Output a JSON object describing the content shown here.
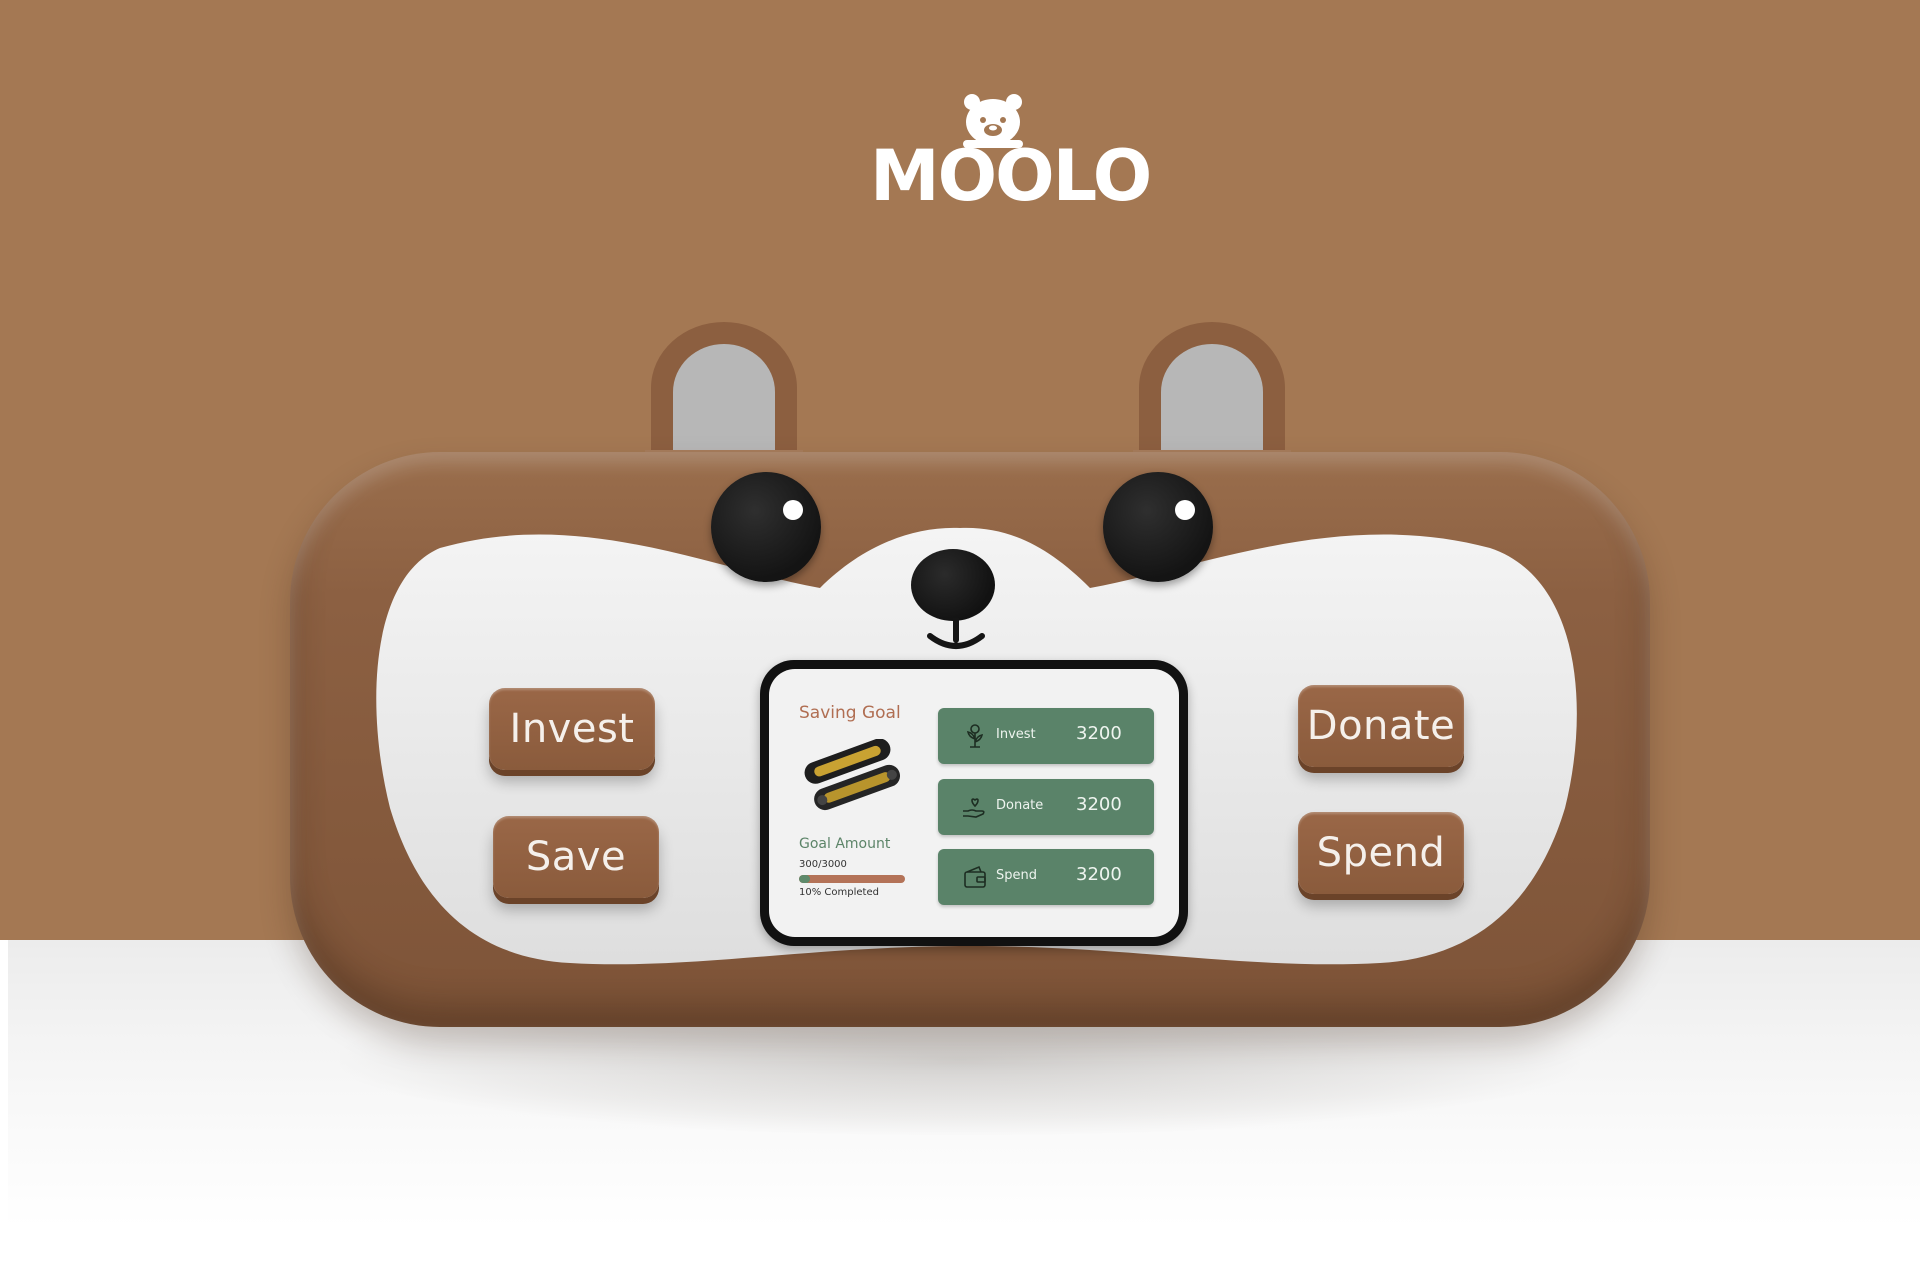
{
  "brand": {
    "logo_text": "MOOLO"
  },
  "device": {
    "left_buttons": [
      "Invest",
      "Save"
    ],
    "right_buttons": [
      "Donate",
      "Spend"
    ],
    "screen": {
      "goal_title": "Saving Goal",
      "goal_amount_title": "Goal Amount",
      "goal_amount_value": "300/3000",
      "progress_fraction": 0.1,
      "progress_label": "10% Completed",
      "actions": [
        {
          "label": "Invest",
          "value": "3200",
          "icon": "plant-coin-icon"
        },
        {
          "label": "Donate",
          "value": "3200",
          "icon": "heart-hand-icon"
        },
        {
          "label": "Spend",
          "value": "3200",
          "icon": "wallet-icon"
        }
      ]
    }
  },
  "colors": {
    "background": "#a47853",
    "device_brown": "#8c6042",
    "button_brown": "#8a5b3c",
    "card_green": "#5a8369",
    "goal_title": "#b06e52",
    "progress_track": "#b47358",
    "progress_fill": "#5e8a6b"
  }
}
